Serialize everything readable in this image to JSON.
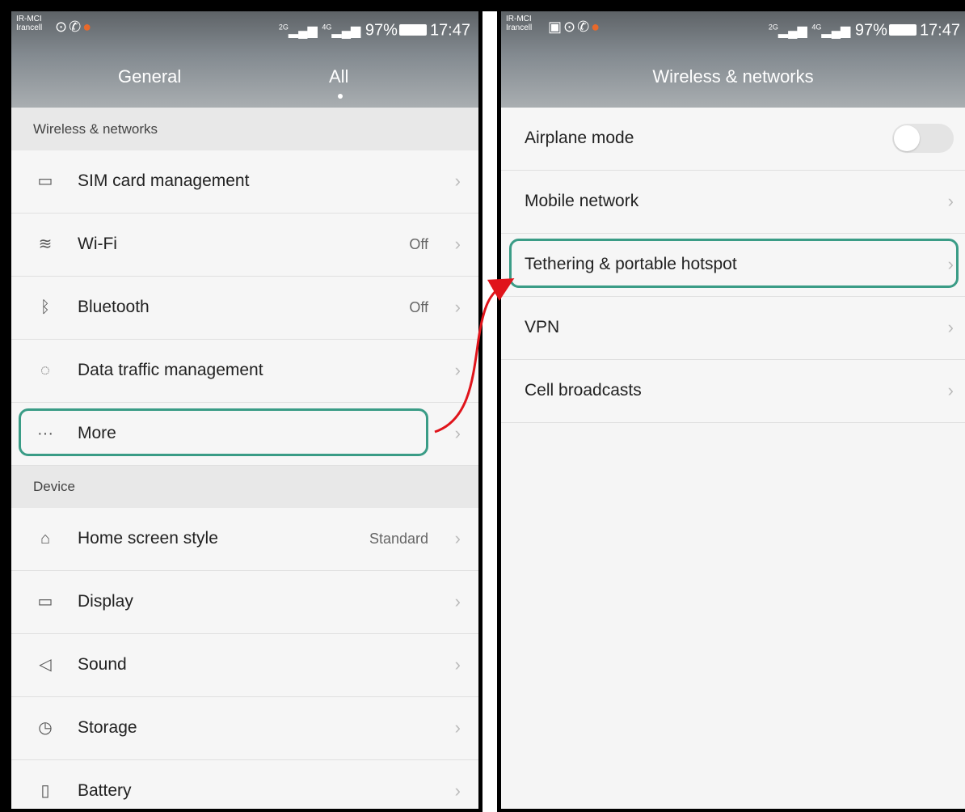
{
  "status": {
    "carrier_line1": "IR-MCI",
    "carrier_line2": "Irancell",
    "net1": "2G",
    "net2": "4G",
    "battery": "97%",
    "time": "17:47"
  },
  "left": {
    "tabs": [
      "General",
      "All"
    ],
    "sections": {
      "wireless": "Wireless & networks",
      "device": "Device"
    },
    "items": [
      {
        "label": "SIM card management",
        "value": "",
        "icon": "sim-card-icon"
      },
      {
        "label": "Wi-Fi",
        "value": "Off",
        "icon": "wifi-icon"
      },
      {
        "label": "Bluetooth",
        "value": "Off",
        "icon": "bluetooth-icon"
      },
      {
        "label": "Data traffic management",
        "value": "",
        "icon": "data-traffic-icon"
      },
      {
        "label": "More",
        "value": "",
        "icon": "more-dots-icon"
      },
      {
        "label": "Home screen style",
        "value": "Standard",
        "icon": "home-icon"
      },
      {
        "label": "Display",
        "value": "",
        "icon": "display-icon"
      },
      {
        "label": "Sound",
        "value": "",
        "icon": "speaker-icon"
      },
      {
        "label": "Storage",
        "value": "",
        "icon": "storage-icon"
      },
      {
        "label": "Battery",
        "value": "",
        "icon": "battery-icon"
      }
    ]
  },
  "right": {
    "title": "Wireless & networks",
    "items": [
      {
        "label": "Airplane mode",
        "toggle": false
      },
      {
        "label": "Mobile network"
      },
      {
        "label": "Tethering & portable hotspot"
      },
      {
        "label": "VPN"
      },
      {
        "label": "Cell broadcasts"
      }
    ]
  },
  "colors": {
    "highlight": "#3a9c86",
    "arrow": "#e0141b"
  }
}
